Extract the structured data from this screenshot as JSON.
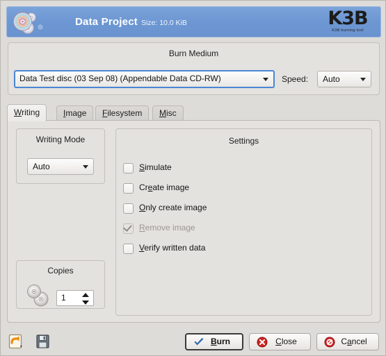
{
  "header": {
    "title": "Data Project",
    "size_text": "Size: 10.0 KiB",
    "logo_main": "K3B",
    "logo_sub": "K3B burning tool",
    "app_icon": "cd-disc-stack-icon",
    "bg_color": "#6d97d3"
  },
  "burn_medium": {
    "group_title": "Burn Medium",
    "medium_value": "Data Test disc (03 Sep 08) (Appendable Data CD-RW)",
    "speed_label": "Speed:",
    "speed_value": "Auto",
    "focus_color": "#4a86d3"
  },
  "tabs": [
    {
      "label": "Writing",
      "accel": "W",
      "active": true
    },
    {
      "label": "Image",
      "accel": "I",
      "active": false
    },
    {
      "label": "Filesystem",
      "accel": "F",
      "active": false
    },
    {
      "label": "Misc",
      "accel": "M",
      "active": false
    }
  ],
  "writing_mode": {
    "group_title": "Writing Mode",
    "value": "Auto"
  },
  "copies": {
    "group_title": "Copies",
    "value": "1",
    "icon": "two-discs-icon"
  },
  "settings": {
    "group_title": "Settings",
    "items": [
      {
        "label": "Simulate",
        "checked": false,
        "disabled": false
      },
      {
        "label": "Create image",
        "checked": false,
        "disabled": false
      },
      {
        "label": "Only create image",
        "checked": false,
        "disabled": false
      },
      {
        "label": "Remove image",
        "checked": true,
        "disabled": true
      },
      {
        "label": "Verify written data",
        "checked": false,
        "disabled": false
      }
    ]
  },
  "bottom_bar": {
    "load_defaults_icon": "load-user-defaults-icon",
    "save_defaults_icon": "save-user-defaults-icon",
    "buttons": [
      {
        "name": "burn",
        "label": "Burn",
        "icon": "check-icon",
        "default": true
      },
      {
        "name": "close",
        "label": "Close",
        "icon": "close-icon",
        "default": false
      },
      {
        "name": "cancel",
        "label": "Cancel",
        "icon": "cancel-icon",
        "default": false
      }
    ]
  }
}
